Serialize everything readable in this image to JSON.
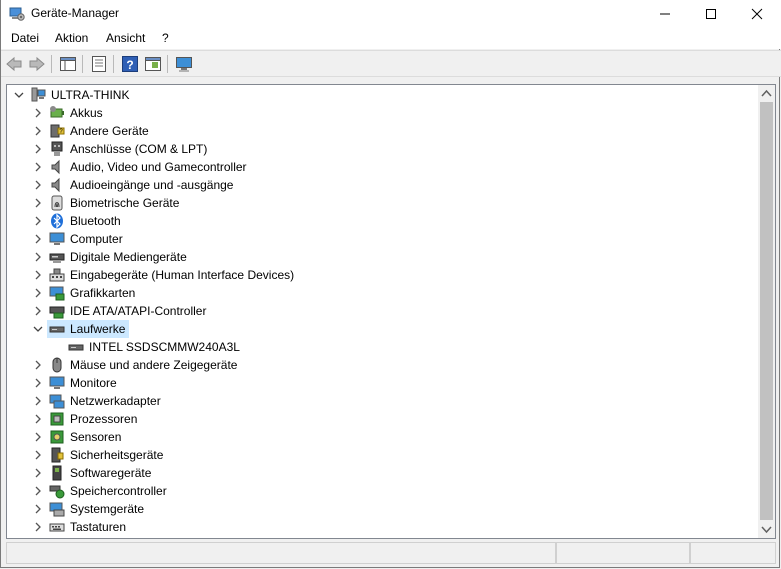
{
  "window": {
    "title": "Geräte-Manager",
    "icon": "device-manager-icon"
  },
  "menubar": {
    "items": [
      "Datei",
      "Aktion",
      "Ansicht",
      "?"
    ]
  },
  "toolbar": {
    "buttons": [
      "back-arrow-icon",
      "forward-arrow-icon",
      "show-hide-console-tree-icon",
      "properties-icon",
      "help-icon",
      "action-pane-icon",
      "monitor-icon"
    ]
  },
  "tree": {
    "root": "ULTRA-THINK",
    "categories": [
      {
        "label": "Akkus",
        "icon": "battery-icon"
      },
      {
        "label": "Andere Geräte",
        "icon": "unknown-device-icon"
      },
      {
        "label": "Anschlüsse (COM & LPT)",
        "icon": "port-icon"
      },
      {
        "label": "Audio, Video und Gamecontroller",
        "icon": "speaker-icon"
      },
      {
        "label": "Audioeingänge und -ausgänge",
        "icon": "speaker-icon"
      },
      {
        "label": "Biometrische Geräte",
        "icon": "fingerprint-icon"
      },
      {
        "label": "Bluetooth",
        "icon": "bluetooth-icon"
      },
      {
        "label": "Computer",
        "icon": "computer-icon"
      },
      {
        "label": "Digitale Mediengeräte",
        "icon": "media-device-icon"
      },
      {
        "label": "Eingabegeräte (Human Interface Devices)",
        "icon": "hid-icon"
      },
      {
        "label": "Grafikkarten",
        "icon": "display-adapter-icon"
      },
      {
        "label": "IDE ATA/ATAPI-Controller",
        "icon": "ide-controller-icon"
      },
      {
        "label": "Laufwerke",
        "icon": "disk-drive-icon",
        "expanded": true,
        "selected": true,
        "children": [
          {
            "label": "INTEL SSDSCMMW240A3L",
            "icon": "disk-drive-icon"
          }
        ]
      },
      {
        "label": "Mäuse und andere Zeigegeräte",
        "icon": "mouse-icon"
      },
      {
        "label": "Monitore",
        "icon": "monitor-icon"
      },
      {
        "label": "Netzwerkadapter",
        "icon": "network-adapter-icon"
      },
      {
        "label": "Prozessoren",
        "icon": "processor-icon"
      },
      {
        "label": "Sensoren",
        "icon": "sensor-icon"
      },
      {
        "label": "Sicherheitsgeräte",
        "icon": "security-device-icon"
      },
      {
        "label": "Softwaregeräte",
        "icon": "software-device-icon"
      },
      {
        "label": "Speichercontroller",
        "icon": "storage-controller-icon"
      },
      {
        "label": "Systemgeräte",
        "icon": "system-device-icon"
      },
      {
        "label": "Tastaturen",
        "icon": "keyboard-icon"
      }
    ]
  },
  "colors": {
    "selection": "#cce8ff",
    "window_bg": "#f0f0f0",
    "tree_bg": "#ffffff"
  }
}
